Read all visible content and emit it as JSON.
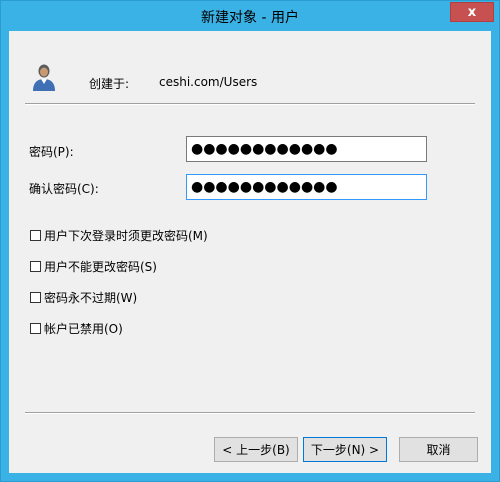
{
  "window": {
    "title": "新建对象 - 用户",
    "close_glyph": "x"
  },
  "header": {
    "created_label": "创建于:",
    "created_value": "ceshi.com/Users",
    "icon": "user-icon"
  },
  "form": {
    "password_label": "密码(P):",
    "password_value": "●●●●●●●●●●●●",
    "confirm_label": "确认密码(C):",
    "confirm_value": "●●●●●●●●●●●●"
  },
  "options": [
    {
      "label": "用户下次登录时须更改密码(M)",
      "checked": false
    },
    {
      "label": "用户不能更改密码(S)",
      "checked": false
    },
    {
      "label": "密码永不过期(W)",
      "checked": false
    },
    {
      "label": "帐户已禁用(O)",
      "checked": false
    }
  ],
  "buttons": {
    "back": "< 上一步(B)",
    "next": "下一步(N) >",
    "cancel": "取消"
  },
  "colors": {
    "titlebar": "#3ab2e6",
    "close": "#c75050",
    "client": "#f0f0f0",
    "focus": "#3399ff"
  }
}
